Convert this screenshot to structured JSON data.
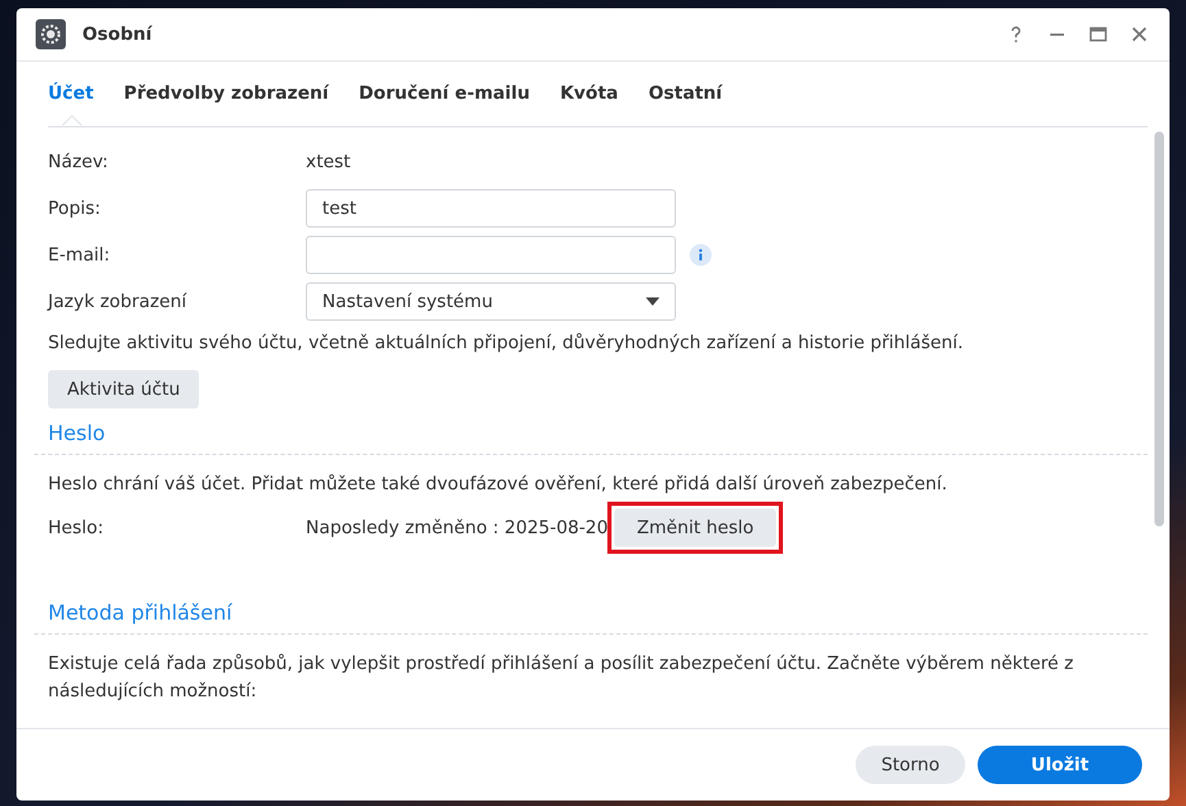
{
  "window": {
    "title": "Osobní"
  },
  "tabs": [
    {
      "label": "Účet",
      "selected": true
    },
    {
      "label": "Předvolby zobrazení",
      "selected": false
    },
    {
      "label": "Doručení e-mailu",
      "selected": false
    },
    {
      "label": "Kvóta",
      "selected": false
    },
    {
      "label": "Ostatní",
      "selected": false
    }
  ],
  "fields": [
    {
      "kind": "static",
      "label": "Název:",
      "value": "xtest"
    },
    {
      "kind": "input",
      "label": "Popis:",
      "value": "test"
    },
    {
      "kind": "input",
      "label": "E-mail:",
      "info": true
    },
    {
      "kind": "select",
      "label": "Jazyk zobrazení",
      "value": "Nastavení systému"
    }
  ],
  "activity": {
    "text": "Sledujte aktivitu svého účtu, včetně aktuálních připojení, důvěryhodných zařízení a historie přihlášení.",
    "button": "Aktivita účtu"
  },
  "sections": [
    {
      "heading": "Heslo",
      "text": "Heslo chrání váš účet. Přidat můžete také dvoufázové ověření, které přidá další úroveň zabezpečení.",
      "row": {
        "label": "Heslo:",
        "value": "Naposledy změněno : 2025-08-20",
        "button": "Změnit heslo",
        "highlighted": true
      }
    },
    {
      "heading": "Metoda přihlášení",
      "text": "Existuje celá řada způsobů, jak vylepšit prostředí přihlášení a posílit zabezpečení účtu. Začněte výběrem některé z následujících možností:"
    }
  ],
  "footer": {
    "buttons": [
      {
        "label": "Storno",
        "kind": "secondary"
      },
      {
        "label": "Uložit",
        "kind": "primary"
      }
    ]
  }
}
